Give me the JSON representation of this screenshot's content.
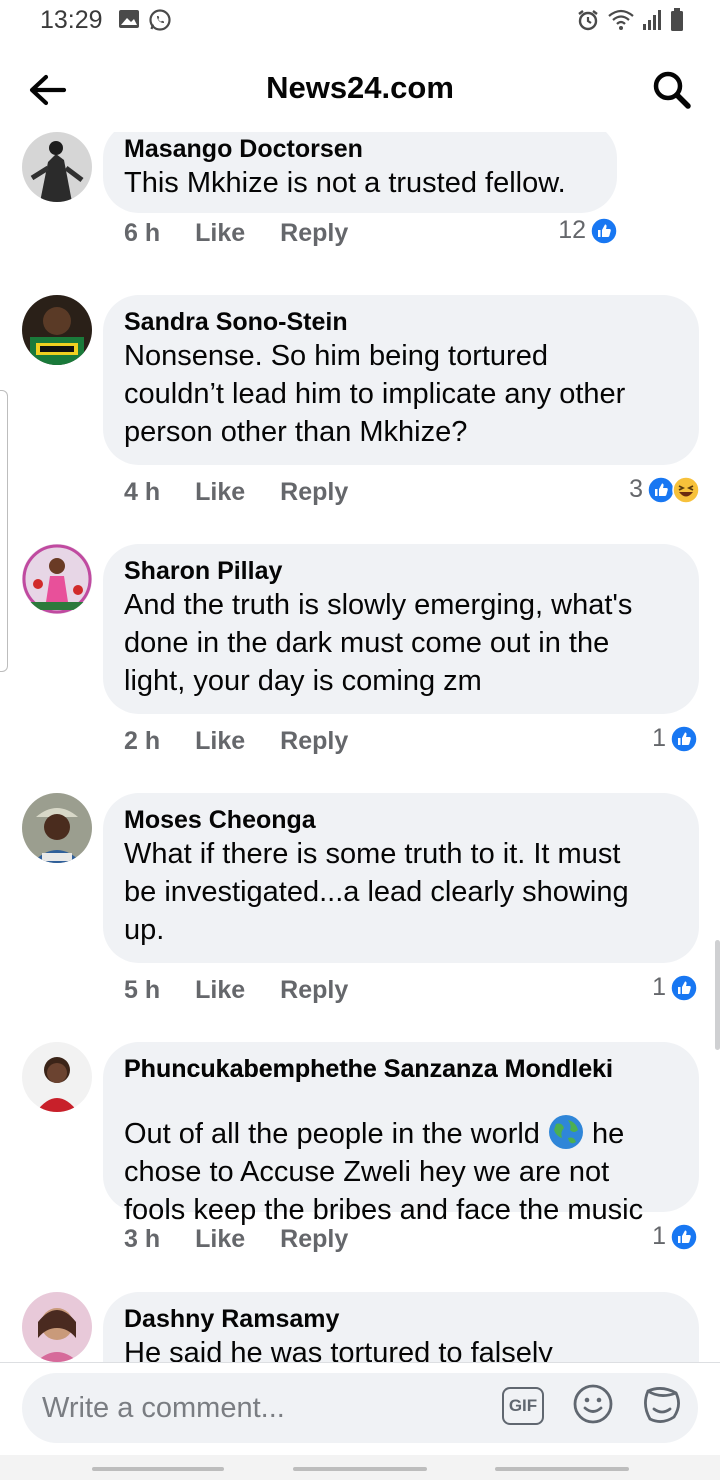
{
  "status_bar": {
    "time": "13:29"
  },
  "header": {
    "title": "News24.com"
  },
  "comments": [
    {
      "author": "Masango Doctorsen",
      "text": "This Mkhize is not a trusted fellow.",
      "time": "6 h",
      "like_label": "Like",
      "reply_label": "Reply",
      "reaction_count": "12",
      "reactions": [
        "like"
      ]
    },
    {
      "author": "Sandra Sono-Stein",
      "text": "Nonsense. So him being tortured\ncouldn’t lead him to implicate any other\nperson other than Mkhize?",
      "time": "4 h",
      "like_label": "Like",
      "reply_label": "Reply",
      "reaction_count": "3",
      "reactions": [
        "like",
        "haha"
      ]
    },
    {
      "author": "Sharon Pillay",
      "text": "And the truth is slowly emerging, what's\ndone in the dark must come out in the\nlight, your day is coming zm",
      "time": "2 h",
      "like_label": "Like",
      "reply_label": "Reply",
      "reaction_count": "1",
      "reactions": [
        "like"
      ]
    },
    {
      "author": "Moses Cheonga",
      "text": "What if there is some truth to it. It must\nbe investigated...a lead clearly showing\nup.",
      "time": "5 h",
      "like_label": "Like",
      "reply_label": "Reply",
      "reaction_count": "1",
      "reactions": [
        "like"
      ]
    },
    {
      "author": "Phuncukabemphethe Sanzanza Mondleki",
      "text_before": "Out of all the people in the world",
      "text_after": " he\nchose to Accuse Zweli hey we are not\nfools keep the bribes and face the music",
      "time": "3 h",
      "like_label": "Like",
      "reply_label": "Reply",
      "reaction_count": "1",
      "reactions": [
        "like"
      ]
    },
    {
      "author": "Dashny Ramsamy",
      "text": "He said he was tortured to falsely"
    }
  ],
  "composer": {
    "placeholder": "Write a comment...",
    "gif_label": "GIF"
  },
  "colors": {
    "like_blue": "#1877f2",
    "bubble_bg": "#f0f2f5",
    "meta_gray": "#65676b"
  }
}
